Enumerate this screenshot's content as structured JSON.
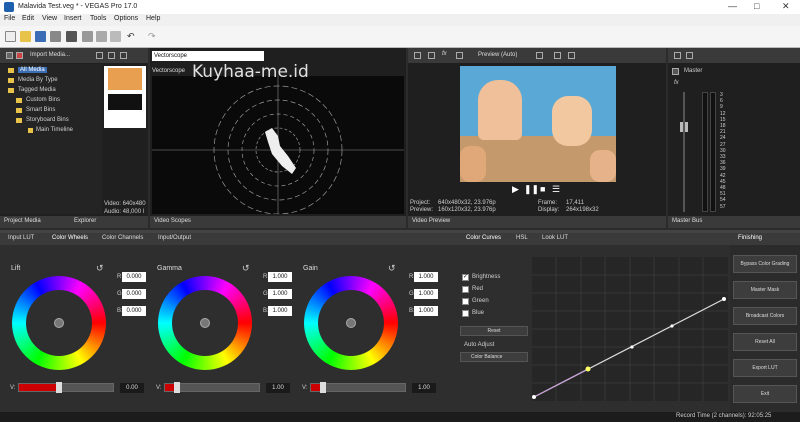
{
  "window": {
    "title": "Malavida Test.veg * - VEGAS Pro 17.0",
    "controls": [
      "—",
      "□",
      "✕"
    ]
  },
  "menu": [
    "File",
    "Edit",
    "View",
    "Insert",
    "Tools",
    "Options",
    "Help"
  ],
  "watermark": "Kuyhaa-me.id",
  "media": {
    "import_label": "Import Media...",
    "tree": [
      "All Media",
      "Media By Type",
      "Tagged Media",
      "Custom Bins",
      "Smart Bins",
      "Storyboard Bins",
      "Main Timeline"
    ],
    "info_lines": [
      "Video: 640x480",
      "Audio: 48,000 l"
    ],
    "tabs": [
      "Project Media",
      "Explorer"
    ]
  },
  "scopes": {
    "dropdown": "Vectorscope",
    "title": "Vectorscope",
    "tab": "Video Scopes"
  },
  "preview": {
    "mode": "Preview (Auto)",
    "project": "Project:",
    "project_val": "640x480x32, 23.976p",
    "preview": "Preview:",
    "preview_val": "160x120x32, 23.976p",
    "frame": "Frame:",
    "frame_val": "17,411",
    "display": "Display:",
    "display_val": "264x198x32",
    "tab": "Video Preview"
  },
  "master": {
    "title": "Master",
    "tab": "Master Bus",
    "scale": [
      "3",
      "6",
      "9",
      "12",
      "15",
      "18",
      "21",
      "24",
      "27",
      "30",
      "33",
      "36",
      "39",
      "42",
      "45",
      "48",
      "51",
      "54",
      "57"
    ]
  },
  "grading": {
    "tabs": [
      "Input LUT",
      "Color Wheels",
      "Color Channels",
      "Input/Output"
    ],
    "wheels": [
      {
        "name": "Lift",
        "r": "0.000",
        "g": "0.000",
        "b": "0.000",
        "v": "0.00",
        "fill": 0.42
      },
      {
        "name": "Gamma",
        "r": "1.000",
        "g": "1.000",
        "b": "1.000",
        "v": "1.00",
        "fill": 0.12
      },
      {
        "name": "Gain",
        "r": "1.000",
        "g": "1.000",
        "b": "1.000",
        "v": "1.00",
        "fill": 0.12
      }
    ],
    "rgb_labels": [
      "R:",
      "G:",
      "B:"
    ],
    "v_label": "V:"
  },
  "curves": {
    "tabs": [
      "Color Curves",
      "HSL",
      "Look LUT"
    ],
    "checks": [
      {
        "label": "Brightness",
        "checked": true
      },
      {
        "label": "Red",
        "checked": false
      },
      {
        "label": "Green",
        "checked": false
      },
      {
        "label": "Blue",
        "checked": false
      }
    ],
    "reset": "Reset",
    "auto_adjust": "Auto Adjust",
    "color_balance": "Color Balance"
  },
  "finishing": {
    "title": "Finishing",
    "buttons": [
      "Bypass Color Grading",
      "Master Mask",
      "Broadcast Colors",
      "Reset All",
      "Export LUT",
      "Exit"
    ]
  },
  "statusbar": {
    "text": "Record Time (2 channels): 92:05:25"
  },
  "colors": {
    "accent_red": "#cc0000",
    "selection": "#3b6fb5"
  }
}
